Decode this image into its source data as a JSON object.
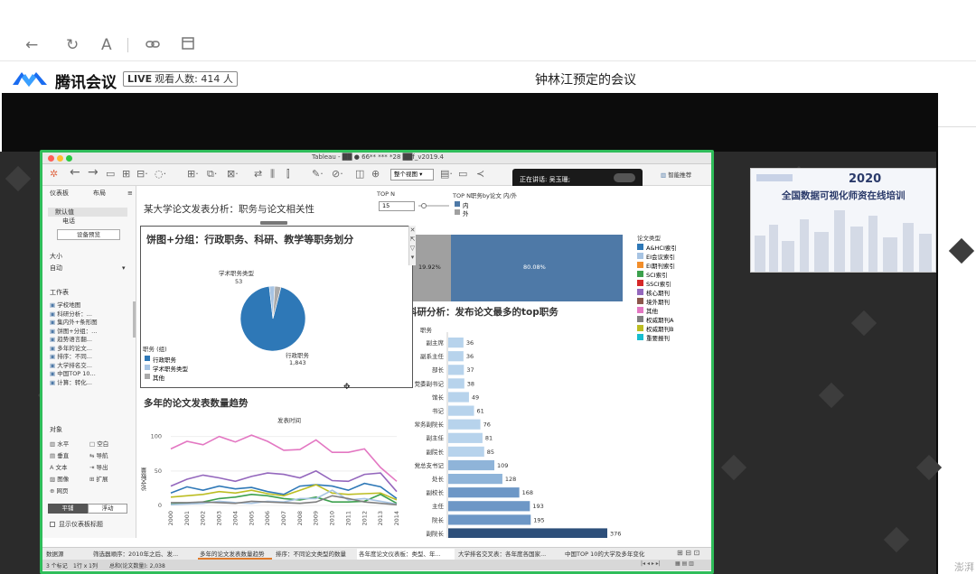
{
  "browser": {
    "reader_icon_label": "A"
  },
  "meeting": {
    "app_name": "腾讯会议",
    "live_badge": "LIVE",
    "viewer_text": "观看人数: 414 人",
    "title": "钟林江预定的会议"
  },
  "tableau": {
    "window_title": "Tableau - ██ ● 66** *** *28 ██f_v2019.4",
    "view_selector": "整个视图",
    "smart_recommend": "智能推荐",
    "speaking_label": "正在讲话: 吴玉珊;",
    "left_panel": {
      "tab_dashboard": "仪表板",
      "tab_layout": "布局",
      "device_default": "默认值",
      "device_phone": "电话",
      "device_preview": "设备预览",
      "size_label": "大小",
      "size_value": "自动",
      "sheets_label": "工作表",
      "sheets": [
        "学校地图",
        "科研分析：...",
        "集内外+条形图",
        "饼图+分组：...",
        "趋势语言翻...",
        "多年的论文...",
        "排序：不同...",
        "大学排名交...",
        "中国TOP 10...",
        "计算：转化..."
      ],
      "objects_label": "对象",
      "objects": [
        [
          "水平",
          "空白"
        ],
        [
          "垂直",
          "导航"
        ],
        [
          "文本",
          "导出"
        ],
        [
          "图像",
          "扩展"
        ],
        [
          "网页",
          ""
        ]
      ],
      "tile_label": "平铺",
      "float_label": "浮动",
      "show_title_label": "显示仪表板标题"
    },
    "dashboard_title": "某大学论文发表分析：职务与论文相关性",
    "topn": {
      "label": "TOP N",
      "value": "15"
    },
    "topn_legend": {
      "title": "TOP N职务by论文 内/外",
      "items": [
        "内",
        "外"
      ],
      "colors": [
        "#4e79a7",
        "#a0a0a0"
      ]
    },
    "split_bar": {
      "left_pct": "19.92%",
      "right_pct": "80.08%"
    },
    "popup": {
      "title": "饼图+分组：行政职务、科研、教学等职务划分",
      "slice_label_title": "学术职务类型",
      "slice_label_value": "53",
      "main_label_title": "行政职务",
      "main_label_value": "1,843",
      "legend_title": "职务 (组)",
      "legend": [
        {
          "label": "行政职务",
          "color": "#2e78b7"
        },
        {
          "label": "学术职务类型",
          "color": "#a7c4e3"
        },
        {
          "label": "其他",
          "color": "#aaaaaa"
        }
      ]
    },
    "paper_types": {
      "title": "论文类型",
      "items": [
        {
          "label": "A&HCI索引",
          "color": "#2e78b7"
        },
        {
          "label": "EI会议索引",
          "color": "#a7c4e3"
        },
        {
          "label": "EI期刊索引",
          "color": "#f28e2b"
        },
        {
          "label": "SCI索引",
          "color": "#3ca04d"
        },
        {
          "label": "SSCI索引",
          "color": "#d62728"
        },
        {
          "label": "核心期刊",
          "color": "#9467bd"
        },
        {
          "label": "境外期刊",
          "color": "#8c564b"
        },
        {
          "label": "其他",
          "color": "#e377c2"
        },
        {
          "label": "权威期刊A",
          "color": "#7f7f7f"
        },
        {
          "label": "权威期刊B",
          "color": "#bcbd22"
        },
        {
          "label": "重要报刊",
          "color": "#17becf"
        }
      ]
    },
    "research": {
      "title": "科研分析：发布论文最多的top职务",
      "axis_label": "职务"
    },
    "trend": {
      "title": "多年的论文发表数量趋势",
      "x_title": "发表时间",
      "y_title": "论文数量"
    },
    "tabs": [
      "数据源",
      "筛选器顺序：2010年之后、发...",
      "多年的论文发表数量趋势",
      "排序：不同论文类型的数量",
      "各年度论文仪表板：类型、年...",
      "大学排名交叉表：各年度各国家...",
      "中国TOP 10的大学及多年变化"
    ],
    "status": {
      "marks": "3 个标记",
      "rows": "1行 x 1列",
      "sum": "总和(论文数量): 2,038"
    }
  },
  "thumbnail": {
    "year": "2020",
    "title": "全国数据可视化师资在线培训"
  },
  "watermark": "澎湃",
  "chart_data": [
    {
      "type": "bar",
      "title": "科研分析：发布论文最多的top职务",
      "ylabel": "职务",
      "categories": [
        "副主席",
        "副系主任",
        "部长",
        "党委副书记",
        "馆长",
        "书记",
        "常务副院长",
        "副主任",
        "副院长",
        "党总支书记",
        "处长",
        "副校长",
        "主任",
        "院长",
        "副院长"
      ],
      "values": [
        36,
        36,
        37,
        38,
        49,
        61,
        76,
        81,
        85,
        109,
        128,
        168,
        193,
        195,
        376
      ]
    },
    {
      "type": "pie",
      "title": "饼图+分组：行政职务、科研、教学等职务划分",
      "categories": [
        "行政职务",
        "学术职务类型",
        "其他"
      ],
      "values": [
        1843,
        53,
        60
      ]
    },
    {
      "type": "line",
      "title": "多年的论文发表数量趋势",
      "xlabel": "发表时间",
      "ylabel": "论文数量",
      "x": [
        "2000",
        "2001",
        "2002",
        "2003",
        "2004",
        "2005",
        "2006",
        "2007",
        "2008",
        "2009",
        "2010",
        "2011",
        "2012",
        "2013",
        "2014"
      ],
      "ylim": [
        0,
        110
      ],
      "y_ticks": [
        "100",
        "50",
        "0"
      ],
      "series": [
        {
          "name": "其他",
          "color": "#e377c2",
          "values": [
            82,
            93,
            88,
            100,
            92,
            102,
            93,
            80,
            81,
            95,
            77,
            77,
            82,
            55,
            35
          ]
        },
        {
          "name": "核心期刊",
          "color": "#9467bd",
          "values": [
            28,
            38,
            44,
            40,
            35,
            42,
            47,
            45,
            40,
            50,
            36,
            35,
            45,
            47,
            20
          ]
        },
        {
          "name": "A&HCI索引",
          "color": "#2e78b7",
          "values": [
            18,
            27,
            22,
            28,
            24,
            26,
            20,
            16,
            28,
            30,
            28,
            22,
            32,
            27,
            10
          ]
        },
        {
          "name": "权威期刊B",
          "color": "#bcbd22",
          "values": [
            12,
            14,
            16,
            20,
            18,
            22,
            17,
            14,
            22,
            30,
            18,
            16,
            17,
            18,
            8
          ]
        },
        {
          "name": "SCI索引",
          "color": "#3ca04d",
          "values": [
            2,
            3,
            5,
            10,
            12,
            16,
            14,
            10,
            8,
            12,
            5,
            5,
            6,
            16,
            3
          ]
        },
        {
          "name": "EI会议索引",
          "color": "#a7c4e3",
          "values": [
            1,
            2,
            3,
            6,
            4,
            3,
            6,
            5,
            10,
            10,
            22,
            8,
            10,
            6,
            2
          ]
        },
        {
          "name": "权威期刊A",
          "color": "#7f7f7f",
          "values": [
            4,
            4,
            5,
            4,
            3,
            6,
            5,
            4,
            3,
            5,
            14,
            10,
            5,
            3,
            1
          ]
        }
      ]
    }
  ]
}
